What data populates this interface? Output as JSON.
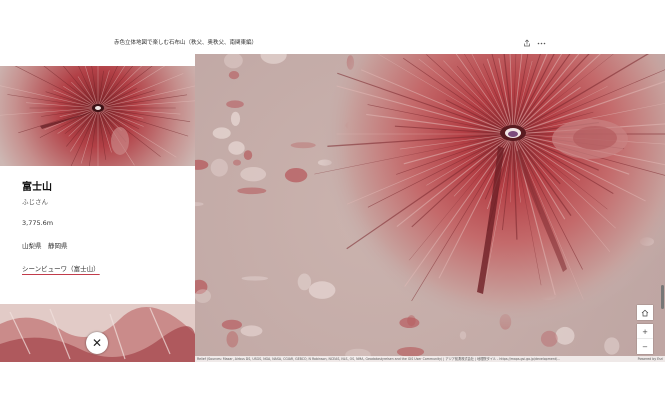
{
  "header": {
    "title": "赤色立体地図で楽しむ石布山（秩父、奥秩父、南関東編）",
    "share_icon": "share-icon",
    "more_icon": "more-icon"
  },
  "panel": {
    "title": "富士山",
    "reading": "ふじさん",
    "elevation": "3,775.6m",
    "location": "山梨県　静岡県",
    "link_label": "シーンビューワ（富士山）"
  },
  "map": {
    "attribution_left": "Relief (Sources: Maxar, Airbus DS, USGS, NGA, NASA, CGIAR, GEBCO, N Robinson, NCEAS, NLS, OS, NMA, Geodatastyrelsen and the GIS User Community) | アジア航測株式会社 | 地理院タイル - https://maps.gsi.go.jp/development/...",
    "attribution_right": "Powered by Esri",
    "home_icon": "home-icon",
    "zoom_in_label": "+",
    "zoom_out_label": "−",
    "colors": {
      "relief_red": "#b8474c",
      "relief_light": "#e6cfcb",
      "relief_grey": "#b7a5a2"
    }
  },
  "close_label": "✕"
}
